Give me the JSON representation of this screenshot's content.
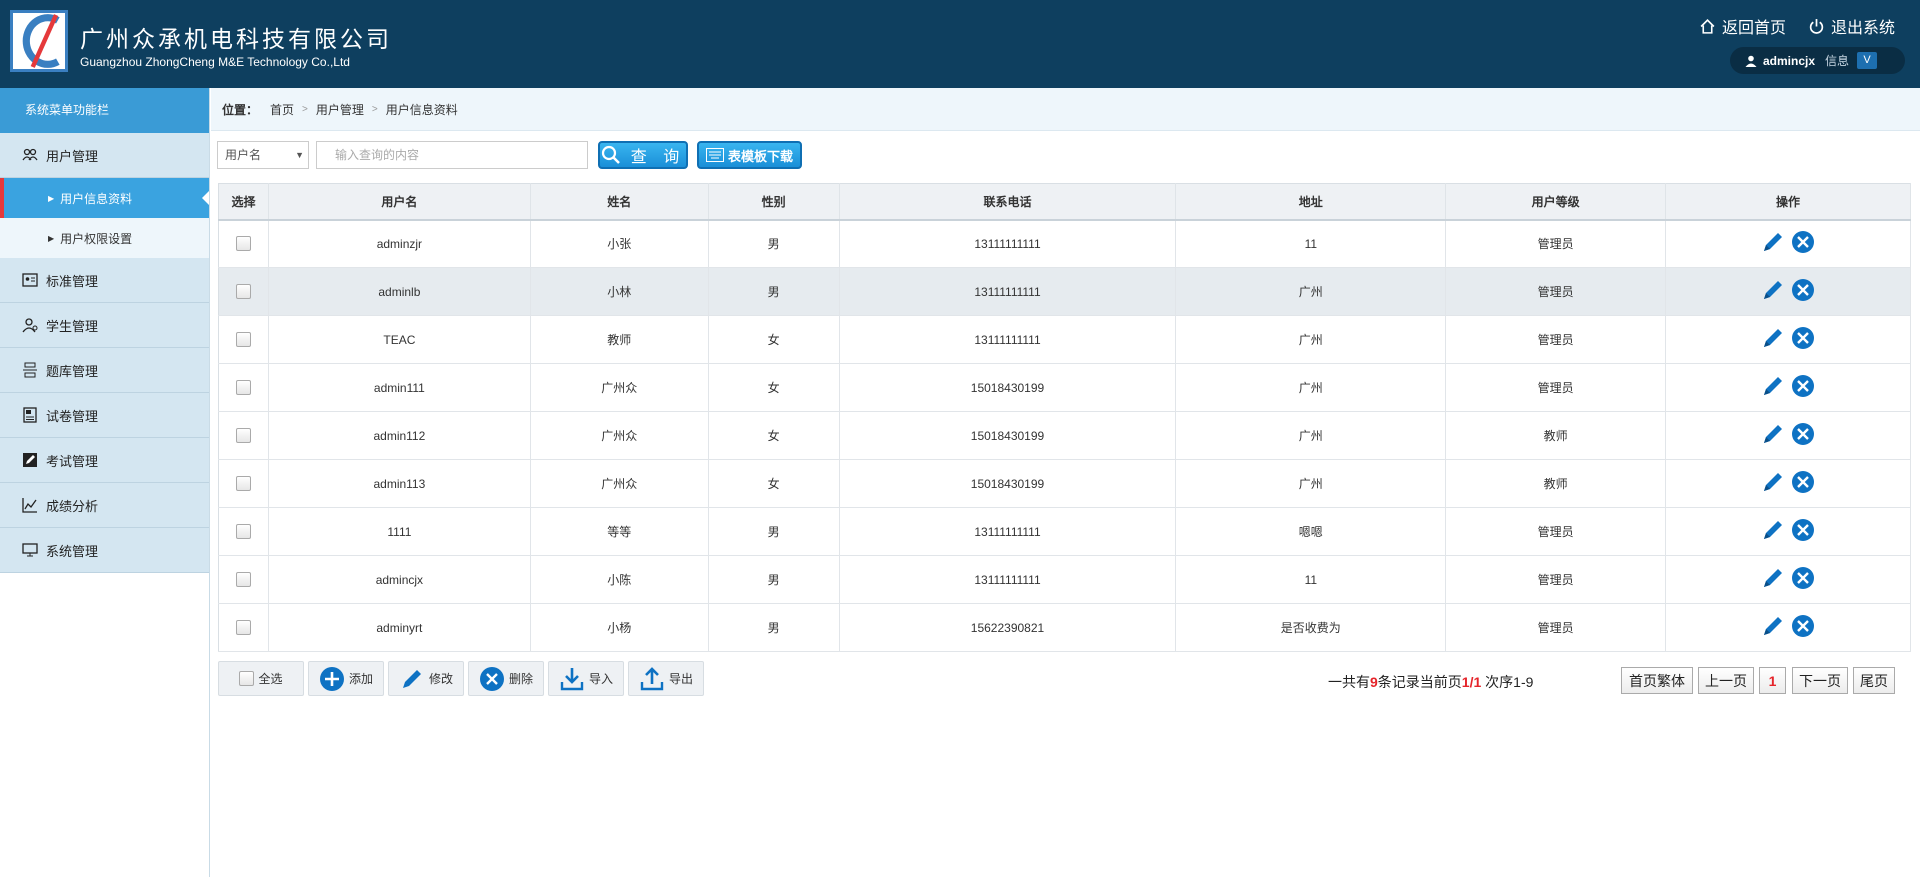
{
  "header": {
    "company_cn": "广州众承机电科技有限公司",
    "company_en": "Guangzhou ZhongCheng M&E Technology Co.,Ltd",
    "home_link": "返回首页",
    "logout_link": "退出系统",
    "user_name": "admincjx",
    "user_info": "信息",
    "user_dropdown": "V"
  },
  "sidebar": {
    "title": "系统菜单功能栏",
    "menu": {
      "user_mgmt": "用户管理",
      "user_info": "用户信息资料",
      "user_perm": "用户权限设置",
      "standard": "标准管理",
      "student": "学生管理",
      "question_bank": "题库管理",
      "paper": "试卷管理",
      "exam": "考试管理",
      "score": "成绩分析",
      "system": "系统管理"
    }
  },
  "breadcrumb": {
    "label": "位置：",
    "items": [
      "首页",
      "用户管理",
      "用户信息资料"
    ]
  },
  "search": {
    "field_select": "用户名",
    "placeholder": "输入查询的内容",
    "query_button": "查 询",
    "download_button": "表模板下载"
  },
  "table": {
    "headers": [
      "选择",
      "用户名",
      "姓名",
      "性别",
      "联系电话",
      "地址",
      "用户等级",
      "操作"
    ],
    "rows": [
      [
        "adminzjr",
        "小张",
        "男",
        "13111111111",
        "11",
        "管理员"
      ],
      [
        "adminlb",
        "小林",
        "男",
        "13111111111",
        "广州",
        "管理员"
      ],
      [
        "TEAC",
        "教师",
        "女",
        "13111111111",
        "广州",
        "管理员"
      ],
      [
        "admin111",
        "广州众",
        "女",
        "15018430199",
        "广州",
        "管理员"
      ],
      [
        "admin112",
        "广州众",
        "女",
        "15018430199",
        "广州",
        "教师"
      ],
      [
        "admin113",
        "广州众",
        "女",
        "15018430199",
        "广州",
        "教师"
      ],
      [
        "1111",
        "等等",
        "男",
        "13111111111",
        "嗯嗯",
        "管理员"
      ],
      [
        "admincjx",
        "小陈",
        "男",
        "13111111111",
        "11",
        "管理员"
      ],
      [
        "adminyrt",
        "小杨",
        "男",
        "15622390821",
        "是否收费为",
        "管理员"
      ]
    ]
  },
  "toolbar": {
    "select_all": "全选",
    "add": "添加",
    "edit": "修改",
    "delete": "删除",
    "import": "导入",
    "export": "导出"
  },
  "pager": {
    "prefix": "一共有",
    "total": "9",
    "mid": "条记录当前页",
    "page": "1/1",
    "suffix": " 次序1-9",
    "first": "首页繁体",
    "prev": "上一页",
    "current": "1",
    "next": "下一页",
    "last": "尾页"
  },
  "colors": {
    "header_bg": "#0e3f5f",
    "accent_blue": "#1a8fd8",
    "active_red": "#e5393b",
    "icon_blue": "#0e72c3"
  }
}
